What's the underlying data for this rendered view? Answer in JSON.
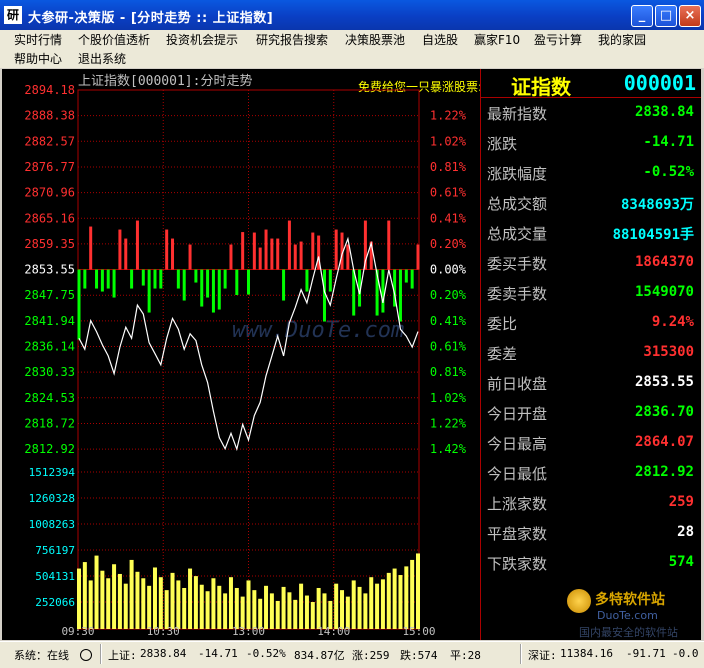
{
  "window": {
    "icon_text": "研",
    "title": "大参研-决策版 - [分时走势 :: 上证指数]",
    "min_label": "_",
    "max_label": "□",
    "close_label": "×"
  },
  "menu": [
    "实时行情",
    "个股价值透析",
    "投资机会提示",
    "研究报告搜索",
    "决策股票池",
    "自选股",
    "赢家F10",
    "盈亏计算",
    "我的家园",
    "帮助中心",
    "退出系统"
  ],
  "chart": {
    "title": "上证指数[000001]:分时走势",
    "ad_text": "免费给您一只暴涨股票:",
    "watermark": "www.DuoTe.com",
    "price_ticks": [
      "2894.18",
      "2888.38",
      "2882.57",
      "2876.77",
      "2870.96",
      "2865.16",
      "2859.35",
      "2853.55",
      "2847.75",
      "2841.94",
      "2836.14",
      "2830.33",
      "2824.53",
      "2818.72",
      "2812.92"
    ],
    "pct_ticks": [
      "1.22%",
      "1.02%",
      "0.81%",
      "0.61%",
      "0.41%",
      "0.20%",
      "0.00%",
      "0.20%",
      "0.41%",
      "0.61%",
      "0.81%",
      "1.02%",
      "1.22%",
      "1.42%"
    ],
    "volume_ticks": [
      "1512394",
      "1260328",
      "1008263",
      "756197",
      "504131",
      "252066"
    ],
    "time_ticks": [
      "09:30",
      "10:30",
      "13:00",
      "14:00",
      "15:00"
    ],
    "colors": {
      "up": "#ff3030",
      "down": "#00ff00",
      "flat": "#ffffff",
      "grid": "#aa0000",
      "volume": "#ffff55",
      "line": "#ffffff"
    }
  },
  "chart_data": {
    "type": "line",
    "title": "上证指数[000001]:分时走势",
    "x_labels": [
      "09:30",
      "10:30",
      "13:00",
      "14:00",
      "15:00"
    ],
    "prev_close": 2853.55,
    "ylim": [
      2812.92,
      2894.18
    ],
    "series": [
      {
        "values": [
          2838.0,
          2835.5,
          2842.0,
          2839.5,
          2836.5,
          2834.0,
          2830.0,
          2836.0,
          2840.5,
          2838.0,
          2845.5,
          2843.5,
          2837.0,
          2834.5,
          2832.0,
          2838.0,
          2842.5,
          2840.0,
          2835.5,
          2839.0,
          2837.5,
          2832.0,
          2828.0,
          2821.5,
          2815.5,
          2813.0,
          2816.5,
          2812.92,
          2818.5,
          2815.0,
          2820.5,
          2823.5,
          2829.5,
          2834.0,
          2838.5,
          2834.0,
          2841.5,
          2845.0,
          2849.0,
          2846.0,
          2851.5,
          2856.5,
          2848.5,
          2845.5,
          2851.5,
          2857.0,
          2860.5,
          2853.5,
          2848.0,
          2855.5,
          2859.5,
          2852.5,
          2846.0,
          2853.5,
          2848.0,
          2840.0,
          2838.5,
          2836.0,
          2839.5
        ]
      },
      {
        "name": "Volume",
        "values": [
          560,
          620,
          450,
          680,
          540,
          470,
          600,
          510,
          420,
          640,
          530,
          470,
          400,
          570,
          480,
          360,
          520,
          450,
          380,
          560,
          490,
          410,
          350,
          470,
          400,
          330,
          480,
          380,
          300,
          450,
          360,
          280,
          400,
          330,
          260,
          390,
          340,
          270,
          420,
          310,
          250,
          380,
          330,
          260,
          420,
          360,
          300,
          450,
          390,
          330,
          480,
          420,
          460,
          520,
          560,
          500,
          580,
          640,
          700
        ]
      }
    ],
    "volume_ylim": [
      0,
      1600000
    ]
  },
  "quote": {
    "name": "证指数",
    "code": "000001",
    "rows": [
      {
        "label": "最新指数",
        "value": "2838.84",
        "color": "#00ff00"
      },
      {
        "label": "涨跌",
        "value": "-14.71",
        "color": "#00ff00"
      },
      {
        "label": "涨跌幅度",
        "value": "-0.52%",
        "color": "#00ff00"
      },
      {
        "label": "总成交额",
        "value": "8348693万",
        "color": "#00ffff"
      },
      {
        "label": "总成交量",
        "value": "88104591手",
        "color": "#00ffff"
      },
      {
        "label": "委买手数",
        "value": "1864370",
        "color": "#ff3030"
      },
      {
        "label": "委卖手数",
        "value": "1549070",
        "color": "#00ff00"
      },
      {
        "label": "委比",
        "value": "9.24%",
        "color": "#ff3030"
      },
      {
        "label": "委差",
        "value": "315300",
        "color": "#ff3030"
      },
      {
        "label": "前日收盘",
        "value": "2853.55",
        "color": "#ffffff"
      },
      {
        "label": "今日开盘",
        "value": "2836.70",
        "color": "#00ff00"
      },
      {
        "label": "今日最高",
        "value": "2864.07",
        "color": "#ff3030"
      },
      {
        "label": "今日最低",
        "value": "2812.92",
        "color": "#00ff00"
      },
      {
        "label": "上涨家数",
        "value": "259",
        "color": "#ff3030"
      },
      {
        "label": "平盘家数",
        "value": "28",
        "color": "#ffffff"
      },
      {
        "label": "下跌家数",
        "value": "574",
        "color": "#00ff00"
      }
    ],
    "watermark_title": "多特软件站",
    "watermark_sub": "DuoTe.com",
    "watermark_slogan": "国内最安全的软件站"
  },
  "status": {
    "system": "系统：在线",
    "sh_label": "上证:",
    "sh_index": "2838.84",
    "sh_change": "-14.71",
    "sh_pct": "-0.52%",
    "sh_amount": "834.87亿",
    "up_count": "涨:259",
    "down_count": "跌:574",
    "flat_count": "平:28",
    "sz_label": "深证:",
    "sz_index": "11384.16",
    "sz_change": "-91.71",
    "sz_pct": "-0.0"
  }
}
